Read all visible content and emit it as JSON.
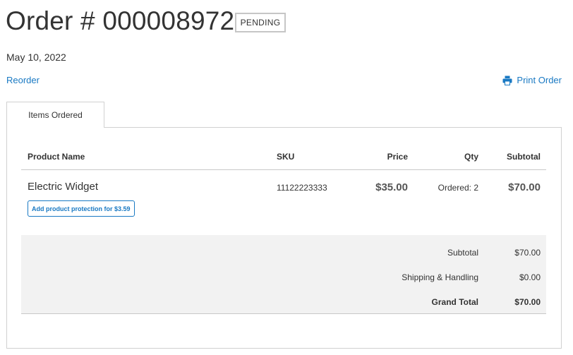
{
  "order": {
    "title": "Order # 000008972",
    "status": "PENDING",
    "date": "May 10, 2022"
  },
  "actions": {
    "reorder_label": "Reorder",
    "print_label": "Print Order",
    "print_icon": "printer-icon"
  },
  "tabs": [
    {
      "label": "Items Ordered"
    }
  ],
  "table": {
    "headers": {
      "product_name": "Product Name",
      "sku": "SKU",
      "price": "Price",
      "qty": "Qty",
      "subtotal": "Subtotal"
    },
    "rows": [
      {
        "product_name": "Electric Widget",
        "protection_label": "Add product protection for $3.59",
        "sku": "11122223333",
        "price": "$35.00",
        "qty": "Ordered: 2",
        "subtotal": "$70.00"
      }
    ]
  },
  "totals": [
    {
      "label": "Subtotal",
      "value": "$70.00"
    },
    {
      "label": "Shipping & Handling",
      "value": "$0.00"
    },
    {
      "label": "Grand Total",
      "value": "$70.00"
    }
  ],
  "colors": {
    "link": "#1979c3",
    "text": "#333333",
    "border": "#d1d1d1",
    "totals_bg": "#f2f2f2"
  }
}
